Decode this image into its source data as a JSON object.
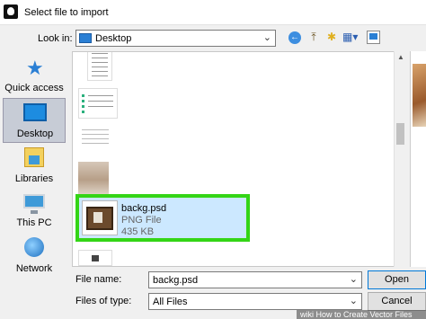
{
  "window": {
    "title": "Select file to import",
    "app_icon": "inkscape-icon"
  },
  "lookin": {
    "label": "Look in:",
    "value": "Desktop"
  },
  "toolbar": {
    "back_icon": "back-arrow-icon",
    "up_icon": "up-folder-icon",
    "new_folder_icon": "new-folder-icon",
    "view_icon": "view-menu-icon",
    "desktop_icon": "desktop-view-icon"
  },
  "places": [
    {
      "label": "Quick access",
      "icon": "star-icon"
    },
    {
      "label": "Desktop",
      "icon": "desktop-icon",
      "selected": true
    },
    {
      "label": "Libraries",
      "icon": "libraries-icon"
    },
    {
      "label": "This PC",
      "icon": "computer-icon"
    },
    {
      "label": "Network",
      "icon": "network-icon"
    }
  ],
  "selected_file": {
    "name": "backg.psd",
    "type": "PNG File",
    "size": "435 KB"
  },
  "filename": {
    "label": "File name:",
    "value": "backg.psd"
  },
  "filetype": {
    "label": "Files of type:",
    "value": "All Files"
  },
  "buttons": {
    "open": "Open",
    "cancel": "Cancel"
  },
  "watermark": "wiki How to Create Vector Files",
  "colors": {
    "highlight_border": "#34d516",
    "selection_fill": "#cce8ff",
    "accent": "#0078d7"
  }
}
